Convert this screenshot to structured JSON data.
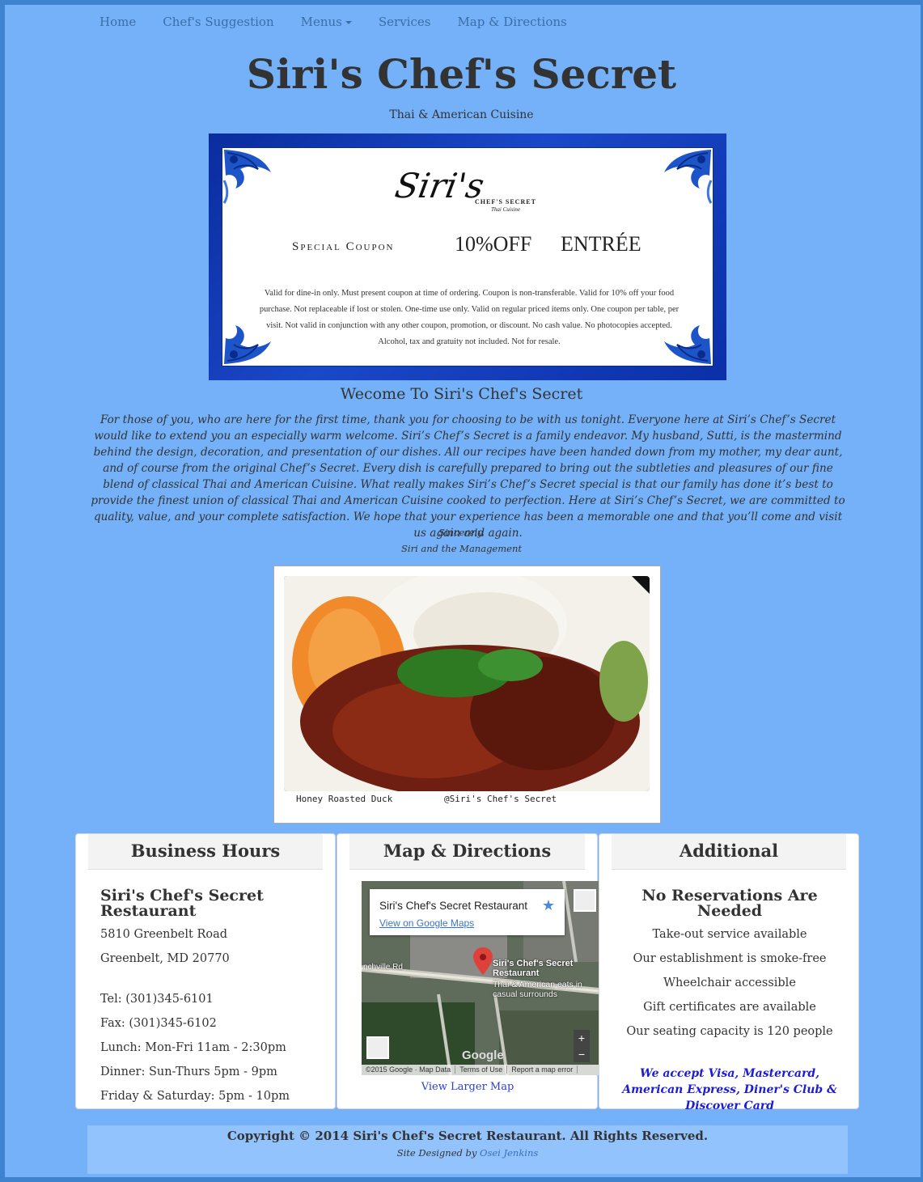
{
  "nav": {
    "items": [
      {
        "label": "Home"
      },
      {
        "label": "Chef's Suggestion"
      },
      {
        "label": "Menus"
      },
      {
        "label": "Services"
      },
      {
        "label": "Map & Directions"
      }
    ]
  },
  "header": {
    "title": "Siri's Chef's Secret",
    "tagline": "Thai & American Cuisine"
  },
  "coupon": {
    "logo_script": "Siri's",
    "logo_sub1": "CHEF'S SECRET",
    "logo_sub2": "Thai Cuisine",
    "special": "Special Coupon",
    "discount": "10%OFF",
    "entree": "ENTRÉE",
    "terms": "Valid for dine-in only. Must present coupon at time of ordering. Coupon is non-transferable. Valid for 10% off your food purchase. Not replaceable if lost or stolen. One-time use only. Valid on regular priced items only. One coupon per table, per visit. Not valid in conjunction with any other coupon, promotion, or discount. No cash value. No photocopies accepted. Alcohol, tax and gratuity not included. Not for resale."
  },
  "welcome": {
    "heading": "Wecome To Siri's Chef's Secret",
    "body": "For those of you, who are here for the first time, thank you for choosing to be with us tonight. Everyone here at Siri’s Chef’s Secret would like to extend you an especially warm welcome. Siri’s Chef’s Secret is a family endeavor. My husband, Sutti, is the mastermind behind the design, decoration, and presentation of our dishes. All our recipes have been handed down from my mother, my dear aunt, and of course from the original Chef’s Secret. Every dish is carefully prepared to bring out the subtleties and pleasures of our fine blend of classical Thai and American Cuisine. What really makes Siri’s Chef’s Secret special is that our family has done it’s best to provide the finest union of classical Thai and American Cuisine cooked to perfection. Here at Siri’s Chef’s Secret, we are committed to quality, value, and your complete satisfaction. We hope that your experience has been a memorable one and that you’ll come and visit us again and again.",
    "sig1": "Sincerely,",
    "sig2": "Siri and the Management"
  },
  "photo": {
    "caption_left": "Honey Roasted Duck",
    "caption_right": "@Siri's Chef's Secret"
  },
  "hours": {
    "heading": "Business Hours",
    "name": "Siri's Chef's Secret Restaurant",
    "address1": "5810 Greenbelt Road",
    "address2": "Greenbelt, MD 20770",
    "tel": "Tel: (301)345-6101",
    "fax": "Fax: (301)345-6102",
    "lunch": "Lunch: Mon-Fri 11am - 2:30pm",
    "dinner": "Dinner: Sun-Thurs 5pm - 9pm",
    "weekend": "Friday & Saturday: 5pm - 10pm"
  },
  "map": {
    "heading": "Map & Directions",
    "card_title": "Siri's Chef's Secret Restaurant",
    "card_link": "View on Google Maps",
    "pin_name": "Siri's Chef's Secret Restaurant",
    "pin_desc": "Thai & American eats in casual surrounds",
    "road": "nchville Rd",
    "google": "Google",
    "footer_items": [
      "©2015 Google · Map Data",
      "Terms of Use",
      "Report a map error"
    ],
    "view_larger": "View Larger Map"
  },
  "additional": {
    "heading": "Additional",
    "title": "No Reservations Are Needed",
    "items": [
      "Take-out service available",
      "Our establishment is smoke-free",
      "Wheelchair accessible",
      "Gift certificates are available",
      "Our seating capacity is 120 people"
    ],
    "cards": "We accept Visa, Mastercard, American Express, Diner's Club & Discover Card"
  },
  "footer": {
    "copyright": "Copyright © 2014 Siri's Chef's Secret Restaurant. All Rights Reserved.",
    "designed_prefix": "Site Designed by",
    "designer": "Osei Jenkins"
  },
  "colors": {
    "page_bg": "#74b1f8",
    "border": "#3f83cf",
    "coupon_bg": "#1a48c8",
    "link": "#3b6ea8",
    "cards_text": "#1c1cd6"
  }
}
